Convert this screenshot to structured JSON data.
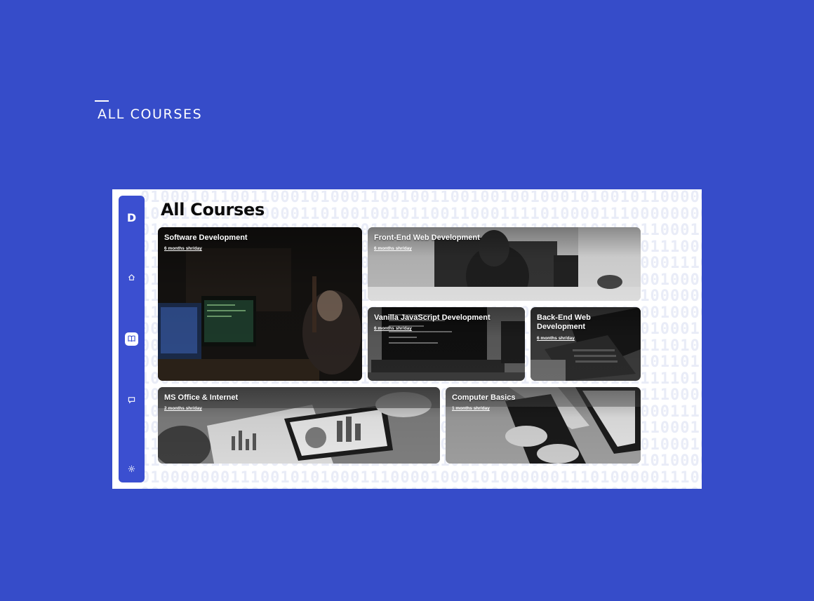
{
  "section": {
    "heading": "ALL COURSES"
  },
  "app": {
    "logo_letter": "D",
    "nav": [
      {
        "name": "home",
        "icon": "home-icon",
        "active": false
      },
      {
        "name": "courses",
        "icon": "book-icon",
        "active": true
      },
      {
        "name": "messages",
        "icon": "chat-icon",
        "active": false
      },
      {
        "name": "settings",
        "icon": "gear-icon",
        "active": false
      }
    ],
    "page_title": "All Courses",
    "courses": [
      {
        "title": "Software Development",
        "duration": "6 months shr/day"
      },
      {
        "title": "Front-End Web Development",
        "duration": "6 months shr/day"
      },
      {
        "title": "Vanilla JavaScript Development",
        "duration": "6 months shr/day"
      },
      {
        "title": "Back-End Web Development",
        "duration": "6 months shr/day"
      },
      {
        "title": "MS Office & Internet",
        "duration": "2 months shr/day"
      },
      {
        "title": "Computer Basics",
        "duration": "1 months shr/day"
      }
    ]
  },
  "colors": {
    "background": "#364cc9",
    "sidebar": "#3b4fd0",
    "frame": "#ffffff"
  }
}
